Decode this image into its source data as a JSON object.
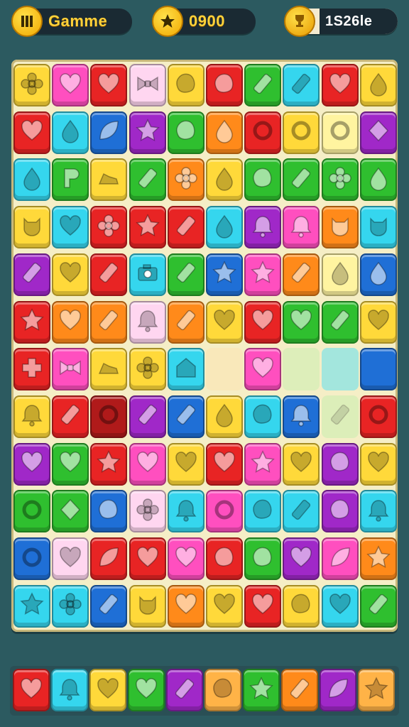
{
  "hud": {
    "level_label": "Gamme",
    "coins_value": "0900",
    "score_value": "1S26le",
    "level_icon": "pause-bars-icon",
    "coin_icon": "star-coin-icon",
    "score_icon": "trophy-icon"
  },
  "palette": {
    "yellow": "#ffd93a",
    "pink": "#ff4fbf",
    "red": "#e82424",
    "lightpink": "#ffd6f0",
    "orange": "#ff8a1a",
    "green": "#2fbf2f",
    "cyan": "#35d6ee",
    "blue": "#1f6fd6",
    "purple": "#a028c8",
    "lime": "#7ed957",
    "peach": "#ffb347",
    "lightyellow": "#fff4a0",
    "darkred": "#b01a1a",
    "empty_cyan": "#5fe0f0",
    "empty_lime": "#c8efb0",
    "empty_peach": "#fbe3b0"
  },
  "board": {
    "rows": [
      [
        [
          "yellow",
          "flower"
        ],
        [
          "pink",
          "heart"
        ],
        [
          "red",
          "heart"
        ],
        [
          "lightpink",
          "bow"
        ],
        [
          "yellow",
          "blob"
        ],
        [
          "red",
          "blob"
        ],
        [
          "green",
          "bar"
        ],
        [
          "cyan",
          "bar"
        ],
        [
          "red",
          "heart"
        ],
        [
          "yellow",
          "drop"
        ]
      ],
      [
        [
          "red",
          "heart"
        ],
        [
          "cyan",
          "drop"
        ],
        [
          "blue",
          "leaf"
        ],
        [
          "purple",
          "star"
        ],
        [
          "green",
          "blob"
        ],
        [
          "orange",
          "drop"
        ],
        [
          "red",
          "ring"
        ],
        [
          "yellow",
          "ring"
        ],
        [
          "lightyellow",
          "ring"
        ],
        [
          "purple",
          "gem"
        ]
      ],
      [
        [
          "cyan",
          "drop"
        ],
        [
          "green",
          "letter"
        ],
        [
          "yellow",
          "shoe"
        ],
        [
          "green",
          "bar"
        ],
        [
          "orange",
          "flower"
        ],
        [
          "yellow",
          "drop"
        ],
        [
          "green",
          "blob"
        ],
        [
          "green",
          "bar"
        ],
        [
          "green",
          "flower"
        ],
        [
          "green",
          "drop"
        ]
      ],
      [
        [
          "yellow",
          "cat"
        ],
        [
          "cyan",
          "heart"
        ],
        [
          "red",
          "flower"
        ],
        [
          "red",
          "star"
        ],
        [
          "red",
          "bar"
        ],
        [
          "cyan",
          "drop"
        ],
        [
          "purple",
          "bell"
        ],
        [
          "pink",
          "bell"
        ],
        [
          "orange",
          "cat"
        ],
        [
          "cyan",
          "cat"
        ]
      ],
      [
        [
          "purple",
          "bar"
        ],
        [
          "yellow",
          "heart"
        ],
        [
          "red",
          "bar"
        ],
        [
          "cyan",
          "camera"
        ],
        [
          "green",
          "bar"
        ],
        [
          "blue",
          "star"
        ],
        [
          "pink",
          "star"
        ],
        [
          "orange",
          "bar"
        ],
        [
          "lightyellow",
          "drop"
        ],
        [
          "blue",
          "drop"
        ]
      ],
      [
        [
          "red",
          "star"
        ],
        [
          "orange",
          "heart"
        ],
        [
          "orange",
          "bar"
        ],
        [
          "lightpink",
          "bell"
        ],
        [
          "orange",
          "bar"
        ],
        [
          "yellow",
          "heart"
        ],
        [
          "red",
          "heart"
        ],
        [
          "green",
          "heart"
        ],
        [
          "green",
          "bar"
        ],
        [
          "yellow",
          "heart"
        ]
      ],
      [
        [
          "red",
          "cross"
        ],
        [
          "pink",
          "bow"
        ],
        [
          "yellow",
          "shoe"
        ],
        [
          "yellow",
          "flower"
        ],
        [
          "cyan",
          "house"
        ],
        [
          "empty_peach",
          "none"
        ],
        [
          "pink",
          "heart"
        ],
        [
          "empty_lime",
          "none"
        ],
        [
          "empty_cyan",
          "none"
        ],
        [
          "blue",
          "none"
        ]
      ],
      [
        [
          "yellow",
          "bell"
        ],
        [
          "red",
          "bar"
        ],
        [
          "darkred",
          "ring"
        ],
        [
          "purple",
          "bar"
        ],
        [
          "blue",
          "bar"
        ],
        [
          "yellow",
          "drop"
        ],
        [
          "cyan",
          "blob"
        ],
        [
          "blue",
          "bell"
        ],
        [
          "empty_lime",
          "bar"
        ],
        [
          "red",
          "ring"
        ]
      ],
      [
        [
          "purple",
          "heart"
        ],
        [
          "green",
          "heart"
        ],
        [
          "red",
          "star"
        ],
        [
          "pink",
          "heart"
        ],
        [
          "yellow",
          "heart"
        ],
        [
          "red",
          "heart"
        ],
        [
          "pink",
          "star"
        ],
        [
          "yellow",
          "heart"
        ],
        [
          "purple",
          "blob"
        ],
        [
          "yellow",
          "heart"
        ]
      ],
      [
        [
          "green",
          "ring"
        ],
        [
          "green",
          "gem"
        ],
        [
          "blue",
          "blob"
        ],
        [
          "lightpink",
          "flower"
        ],
        [
          "cyan",
          "bell"
        ],
        [
          "pink",
          "ring"
        ],
        [
          "cyan",
          "blob"
        ],
        [
          "cyan",
          "bar"
        ],
        [
          "purple",
          "blob"
        ],
        [
          "cyan",
          "bell"
        ]
      ],
      [
        [
          "blue",
          "ring"
        ],
        [
          "lightpink",
          "heart"
        ],
        [
          "red",
          "leaf"
        ],
        [
          "red",
          "heart"
        ],
        [
          "pink",
          "heart"
        ],
        [
          "red",
          "blob"
        ],
        [
          "green",
          "blob"
        ],
        [
          "purple",
          "heart"
        ],
        [
          "pink",
          "leaf"
        ],
        [
          "orange",
          "star"
        ]
      ],
      [
        [
          "cyan",
          "star"
        ],
        [
          "cyan",
          "flower"
        ],
        [
          "blue",
          "bar"
        ],
        [
          "yellow",
          "cat"
        ],
        [
          "orange",
          "heart"
        ],
        [
          "yellow",
          "heart"
        ],
        [
          "red",
          "heart"
        ],
        [
          "yellow",
          "blob"
        ],
        [
          "cyan",
          "heart"
        ],
        [
          "green",
          "bar"
        ]
      ]
    ]
  },
  "tray": {
    "slots": [
      [
        "red",
        "heart"
      ],
      [
        "cyan",
        "bell"
      ],
      [
        "yellow",
        "heart"
      ],
      [
        "green",
        "heart"
      ],
      [
        "purple",
        "bar"
      ],
      [
        "peach",
        "blob"
      ],
      [
        "green",
        "star"
      ],
      [
        "orange",
        "bar"
      ],
      [
        "purple",
        "leaf"
      ],
      [
        "peach",
        "star"
      ]
    ]
  }
}
